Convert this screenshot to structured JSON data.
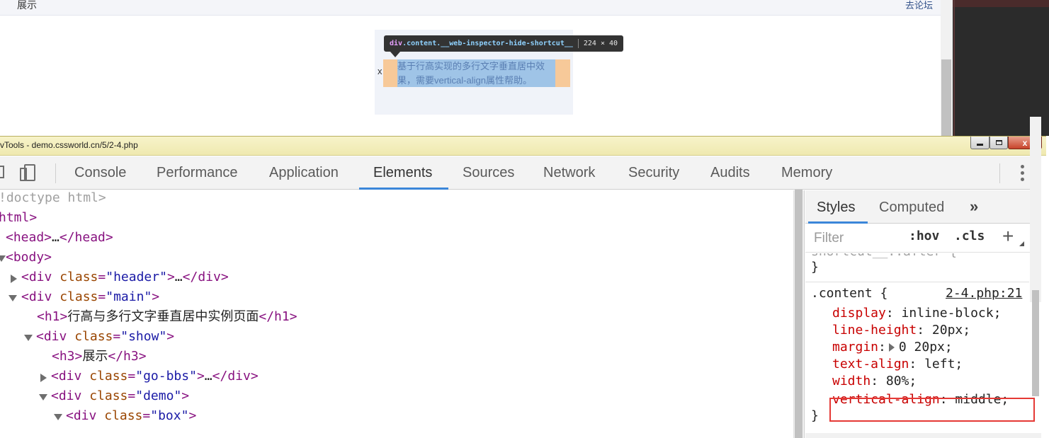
{
  "page": {
    "h3": "展示",
    "go_bbs": "去论坛",
    "demo_x": "x",
    "content_text": "基于行高实现的多行文字垂直居中效果，需要vertical-align属性帮助。"
  },
  "tooltip": {
    "tag": "div",
    "classes": ".content.__web-inspector-hide-shortcut__",
    "size": "224 × 40"
  },
  "window": {
    "title": "vTools - demo.cssworld.cn/5/2-4.php",
    "close_label": "x"
  },
  "devtools_tabs": [
    {
      "label": "Console"
    },
    {
      "label": "Performance"
    },
    {
      "label": "Application"
    },
    {
      "label": "Elements"
    },
    {
      "label": "Sources"
    },
    {
      "label": "Network"
    },
    {
      "label": "Security"
    },
    {
      "label": "Audits"
    },
    {
      "label": "Memory"
    }
  ],
  "active_tab": "Elements",
  "elements_tree": {
    "doctype": "!doctype html>",
    "html_open": "html>",
    "head_open": "<head>",
    "head_ellipsis": "…",
    "head_close": "</head>",
    "body_open": "<body>",
    "div_open": "<div",
    "div_close": "</div>",
    "ellipsis": "…",
    "attr_class": "class",
    "eq": "=",
    "quote": "\"",
    "gt": ">",
    "header_class": "header",
    "main_class": "main",
    "h1_open": "<h1>",
    "h1_text": "行高与多行文字垂直居中实例页面",
    "h1_close": "</h1>",
    "show_class": "show",
    "h3_open": "<h3>",
    "h3_text": "展示",
    "h3_close": "</h3>",
    "gobbs_class": "go-bbs",
    "demo_class": "demo",
    "box_class": "box"
  },
  "styles": {
    "tabs": [
      {
        "label": "Styles"
      },
      {
        "label": "Computed"
      }
    ],
    "more": "»",
    "filter_placeholder": "Filter",
    "hov": ":hov",
    "cls": ".cls",
    "plus": "+",
    "partial_selector": "shortcut__::after {",
    "closing_brace": "}",
    "rule": {
      "selector": ".content {",
      "source": "2-4.php:21",
      "declarations": [
        {
          "prop": "display",
          "value": "inline-block;"
        },
        {
          "prop": "line-height",
          "value": "20px;"
        },
        {
          "prop": "margin",
          "value": "0 20px;"
        },
        {
          "prop": "text-align",
          "value": "left;"
        },
        {
          "prop": "width",
          "value": "80%;"
        },
        {
          "prop": "vertical-align",
          "value": "middle;"
        }
      ],
      "closing": "}"
    }
  },
  "colors": {
    "accent": "#3b86d9",
    "annotation": "#e53935",
    "margin_highlight": "#f7c999",
    "content_highlight": "#9fc4e7"
  }
}
